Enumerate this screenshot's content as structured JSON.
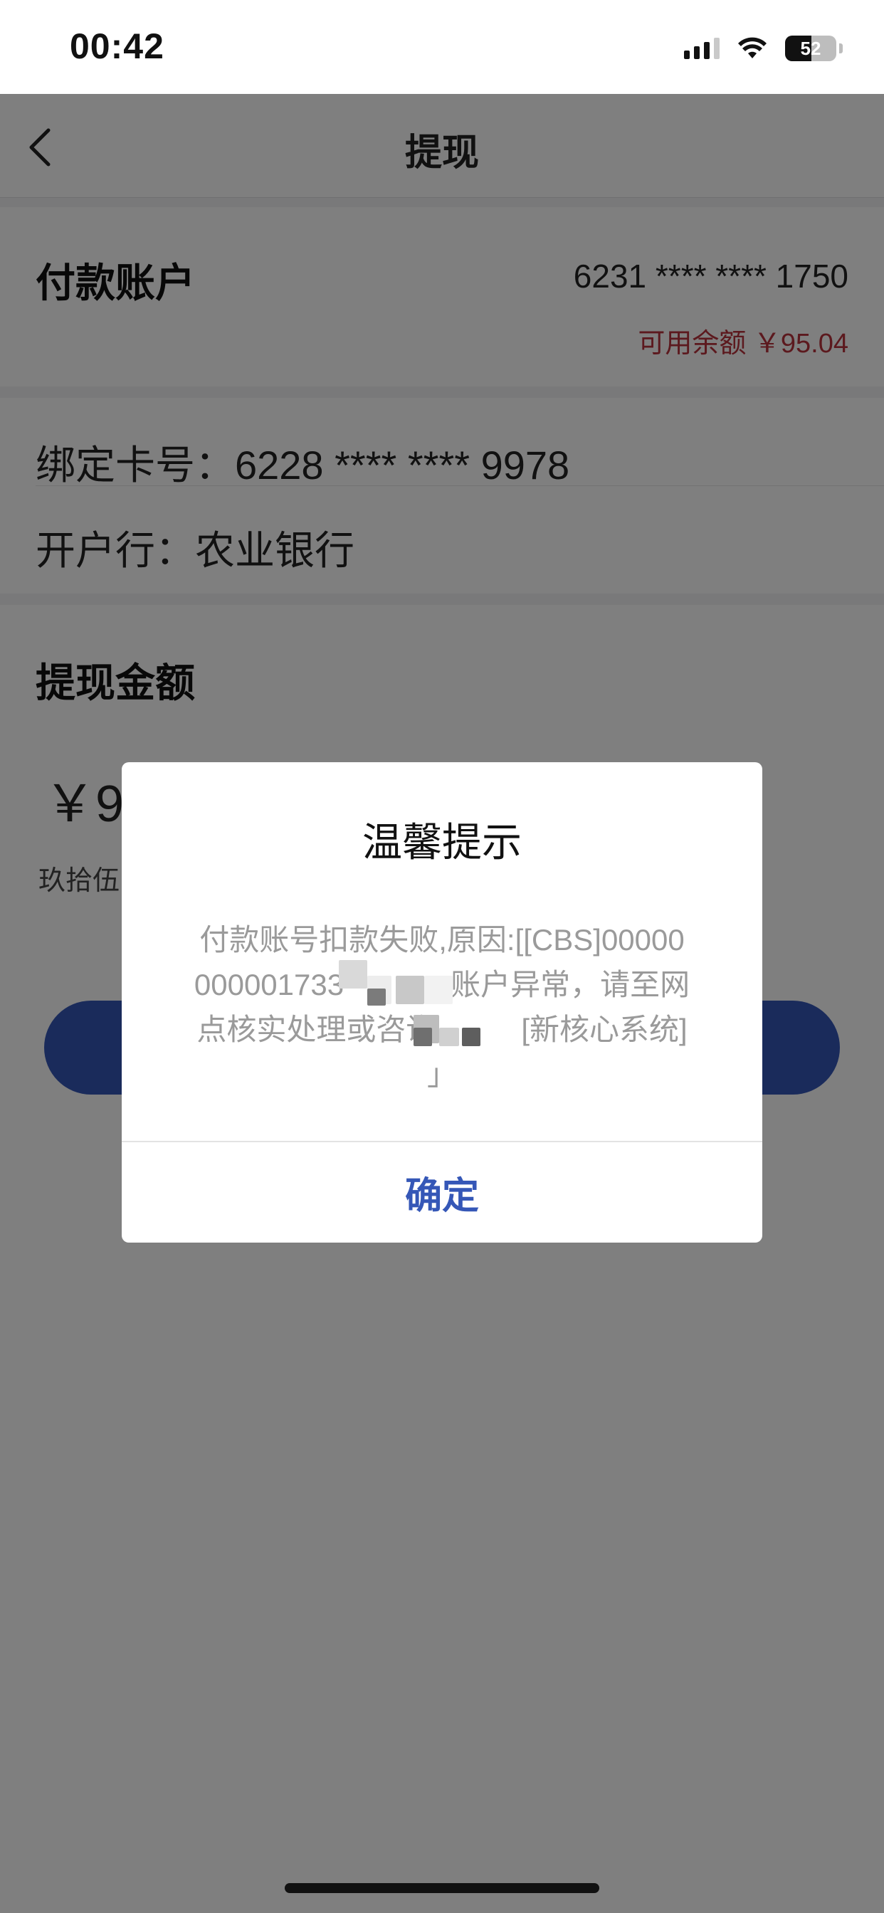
{
  "status_bar": {
    "time": "00:42",
    "battery": "52",
    "icons": [
      "signal-icon",
      "wifi-icon",
      "battery-icon"
    ]
  },
  "nav": {
    "title": "提现",
    "back_icon": "chevron-left-icon"
  },
  "payment_account": {
    "label": "付款账户",
    "card_number": "6231 **** **** 1750",
    "balance": "可用余额 ￥95.04"
  },
  "bound_card": {
    "card_row": "绑定卡号：6228 **** **** 9978",
    "bank_row": "开户行：农业银行"
  },
  "withdraw": {
    "label": "提现金额",
    "amount_visible": "￥9",
    "amount_words_visible": "玖拾伍"
  },
  "dialog": {
    "title": "温馨提示",
    "message_line1": "付款账号扣款失败,原因:[[CBS]00000",
    "message_line2": "000001733",
    "message_line2_tail": "账户异常，请至网",
    "message_line3": "点核实处理或咨询",
    "message_line3_tail": "[新核心系统]",
    "message_line4": "」",
    "ok_label": "确定"
  },
  "colors": {
    "accent": "#3557b7",
    "balance_red": "#b8323c",
    "overlay": "rgba(0,0,0,0.5)"
  }
}
